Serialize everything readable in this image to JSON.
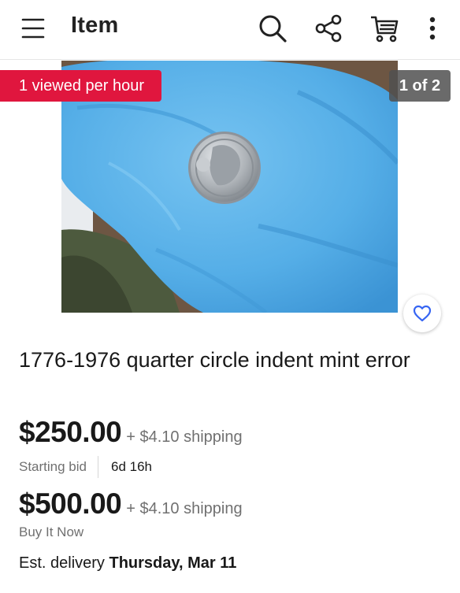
{
  "header": {
    "title": "Item",
    "icons": [
      "menu-icon",
      "search-icon",
      "share-icon",
      "cart-icon",
      "more-vertical-icon"
    ]
  },
  "gallery": {
    "views_badge": "1 viewed per hour",
    "counter": "1 of 2",
    "watch_icon": "heart-icon"
  },
  "item": {
    "title": "1776-1976 quarter circle indent mint error",
    "bid": {
      "price": "$250.00",
      "shipping": "+ $4.10 shipping",
      "label": "Starting bid",
      "time_left": "6d 16h"
    },
    "buy_it_now": {
      "price": "$500.00",
      "shipping": "+ $4.10 shipping",
      "label": "Buy It Now"
    },
    "delivery": {
      "prefix": "Est. delivery",
      "date": "Thursday, Mar 11"
    }
  },
  "colors": {
    "badge_red": "#e0163e",
    "accent_blue": "#3665f3",
    "glove_blue": "#5ab4ec"
  }
}
